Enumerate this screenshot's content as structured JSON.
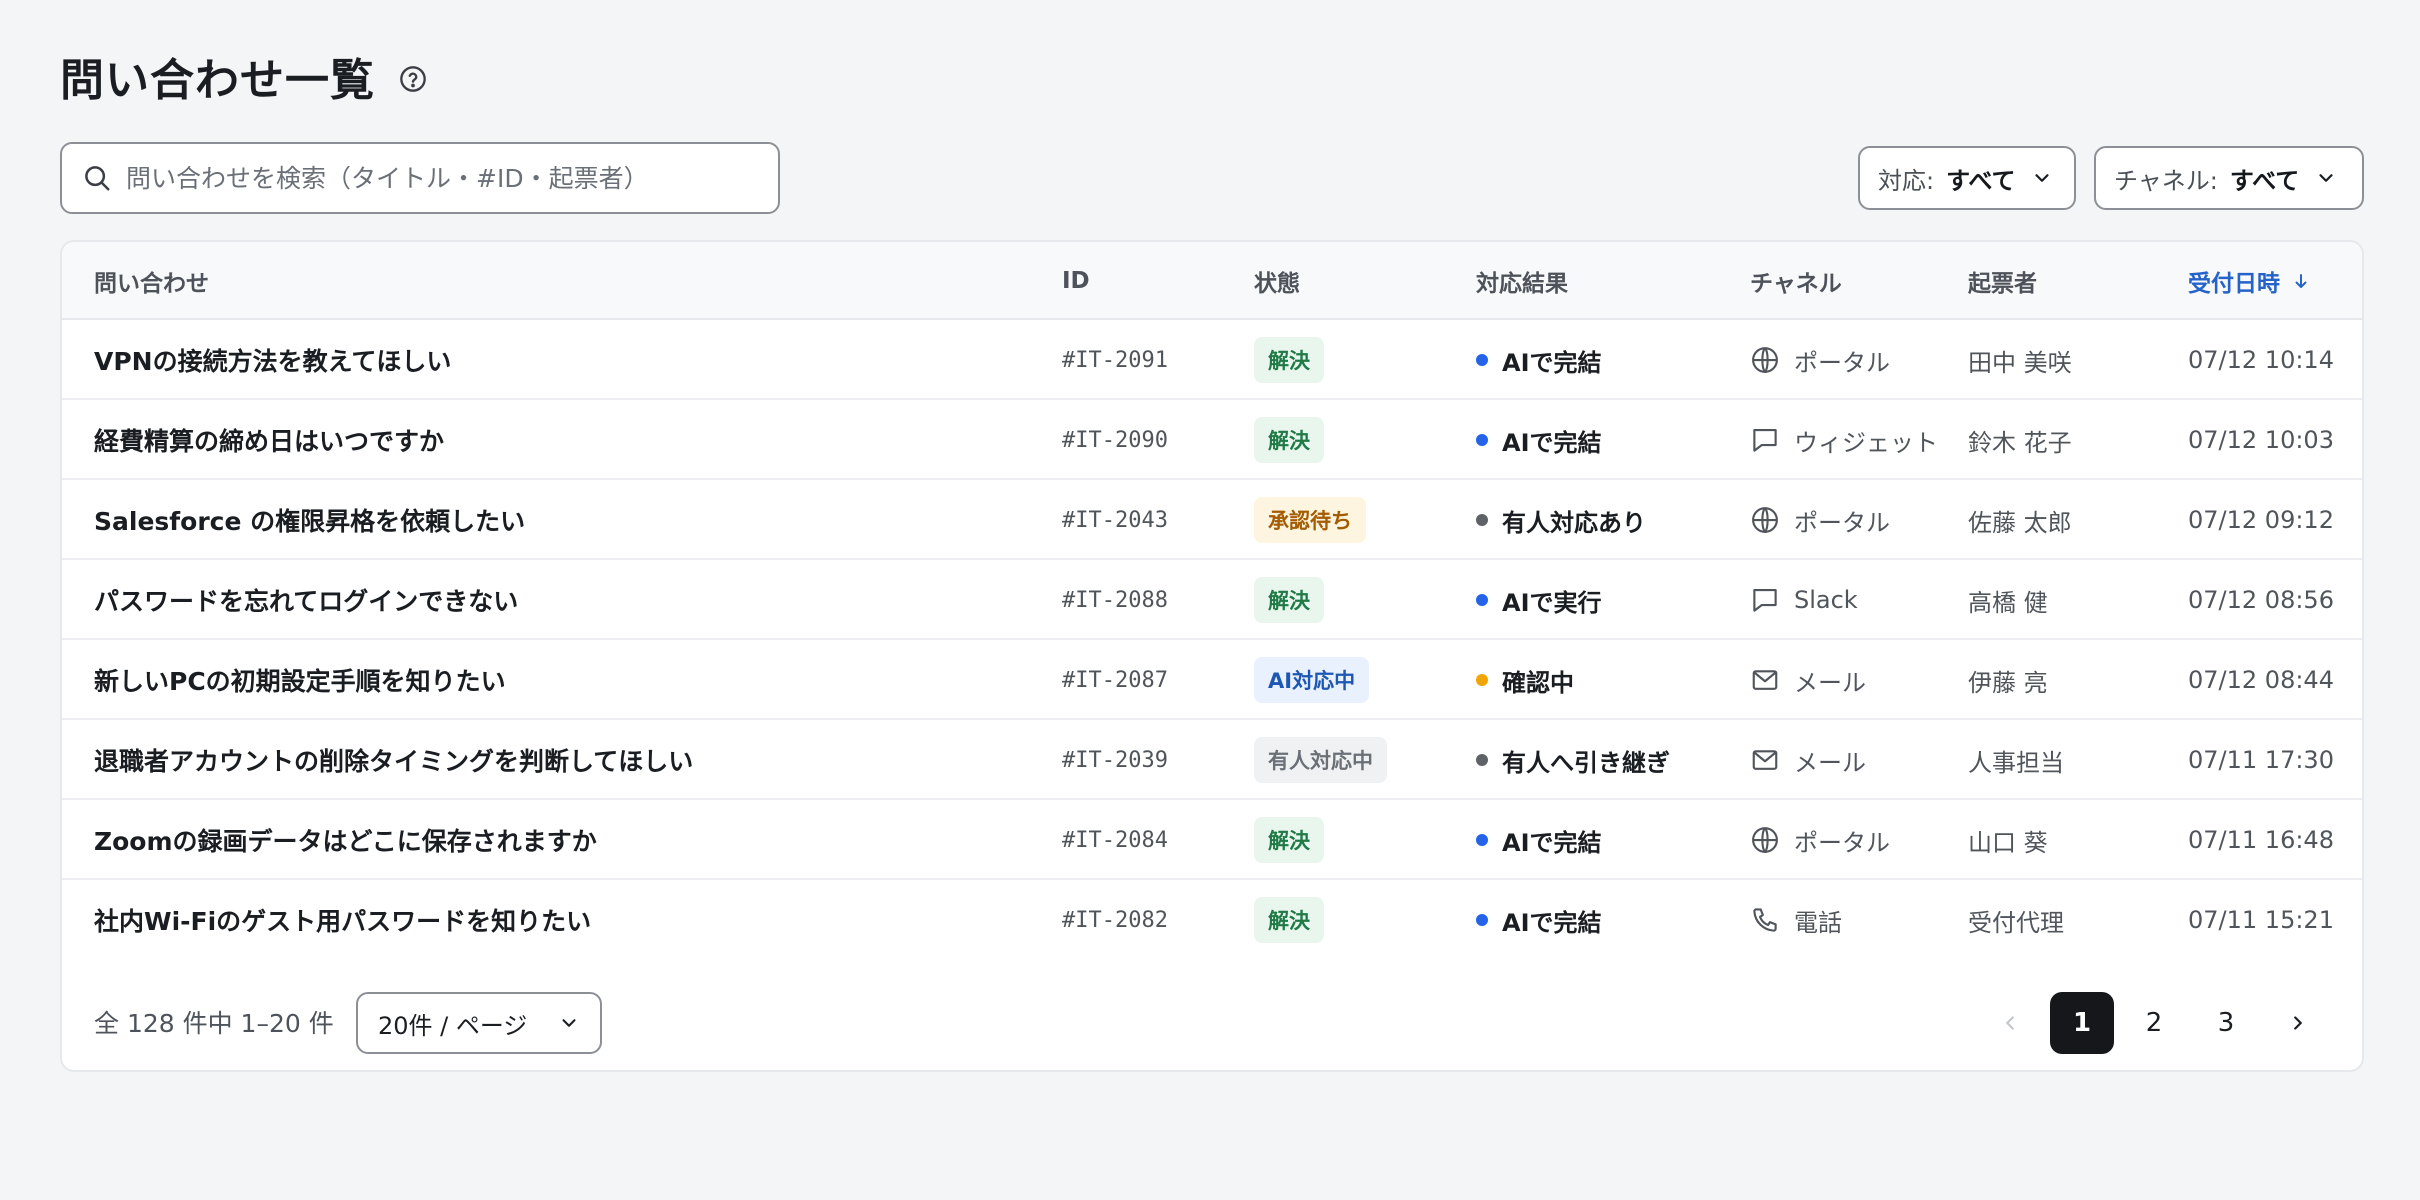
{
  "page": {
    "title": "問い合わせ一覧"
  },
  "search": {
    "placeholder": "問い合わせを検索（タイトル・#ID・起票者）",
    "value": ""
  },
  "filters": {
    "response": {
      "label": "対応:",
      "value": "すべて"
    },
    "channel": {
      "label": "チャネル:",
      "value": "すべて"
    }
  },
  "table": {
    "headers": {
      "title": "問い合わせ",
      "id": "ID",
      "status": "状態",
      "result": "対応結果",
      "channel": "チャネル",
      "requester": "起票者",
      "date": "受付日時"
    },
    "rows": [
      {
        "title": "VPNの接続方法を教えてほしい",
        "id": "#IT-2091",
        "status": "解決",
        "result": "AIで完結",
        "channel": "ポータル",
        "requester": "田中 美咲",
        "date": "07/12 10:14"
      },
      {
        "title": "経費精算の締め日はいつですか",
        "id": "#IT-2090",
        "status": "解決",
        "result": "AIで完結",
        "channel": "ウィジェット",
        "requester": "鈴木 花子",
        "date": "07/12 10:03"
      },
      {
        "title": "Salesforce の権限昇格を依頼したい",
        "id": "#IT-2043",
        "status": "承認待ち",
        "result": "有人対応あり",
        "channel": "ポータル",
        "requester": "佐藤 太郎",
        "date": "07/12 09:12"
      },
      {
        "title": "パスワードを忘れてログインできない",
        "id": "#IT-2088",
        "status": "解決",
        "result": "AIで実行",
        "channel": "Slack",
        "requester": "高橋 健",
        "date": "07/12 08:56"
      },
      {
        "title": "新しいPCの初期設定手順を知りたい",
        "id": "#IT-2087",
        "status": "AI対応中",
        "result": "確認中",
        "channel": "メール",
        "requester": "伊藤 亮",
        "date": "07/12 08:44"
      },
      {
        "title": "退職者アカウントの削除タイミングを判断してほしい",
        "id": "#IT-2039",
        "status": "有人対応中",
        "result": "有人へ引き継ぎ",
        "channel": "メール",
        "requester": "人事担当",
        "date": "07/11 17:30"
      },
      {
        "title": "Zoomの録画データはどこに保存されますか",
        "id": "#IT-2084",
        "status": "解決",
        "result": "AIで完結",
        "channel": "ポータル",
        "requester": "山口 葵",
        "date": "07/11 16:48"
      },
      {
        "title": "社内Wi-Fiのゲスト用パスワードを知りたい",
        "id": "#IT-2082",
        "status": "解決",
        "result": "AIで完結",
        "channel": "電話",
        "requester": "受付代理",
        "date": "07/11 15:21"
      }
    ]
  },
  "pagination": {
    "total_text": "全 128 件中 1–20 件",
    "per_page": "20件 / ページ",
    "pages": [
      "1",
      "2",
      "3"
    ],
    "current": "1"
  },
  "colors": {
    "accent": "#2563c9",
    "dot_ai": "#2563eb",
    "dot_human": "#5f6368",
    "dot_pending": "#f0a500"
  }
}
